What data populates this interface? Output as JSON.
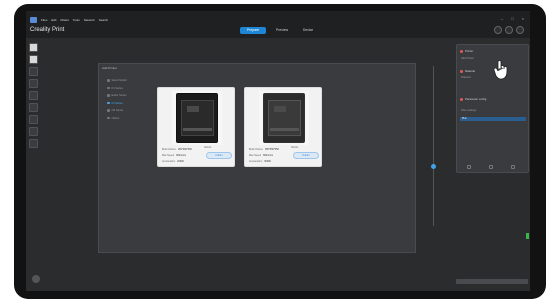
{
  "app": {
    "title": "Creality Print",
    "menu": [
      "Files",
      "Edit",
      "Model",
      "Tools",
      "Network",
      "Search"
    ]
  },
  "tabs": [
    {
      "label": "Prepare",
      "active": true
    },
    {
      "label": "Preview",
      "active": false
    },
    {
      "label": "Device",
      "active": false
    }
  ],
  "dialog": {
    "title": "Add Printer",
    "steps": [
      {
        "label": "Select Model",
        "active": false
      },
      {
        "label": "K1 Series",
        "active": false
      },
      {
        "label": "Ender Series",
        "active": false
      },
      {
        "label": "K2 Series",
        "active": true
      },
      {
        "label": "CR Series",
        "active": false
      },
      {
        "label": "Others",
        "active": false
      }
    ],
    "cards": [
      {
        "specs": [
          {
            "k": "Build Volume",
            "v": "260*260*300"
          },
          {
            "k": "Max Speed",
            "v": "600mm/s"
          },
          {
            "k": "Acceleration",
            "v": "20000"
          }
        ],
        "nozzle_label": "Nozzle",
        "nozzle_value": "0.4mm"
      },
      {
        "specs": [
          {
            "k": "Build Volume",
            "v": "350*350*350"
          },
          {
            "k": "Max Speed",
            "v": "600mm/s"
          },
          {
            "k": "Acceleration",
            "v": "30000"
          }
        ],
        "nozzle_label": "Nozzle",
        "nozzle_value": "0.4mm"
      }
    ]
  },
  "right_panel": {
    "printer_header": "Printer",
    "printer_sub": "Add Printer",
    "material_header": "Material",
    "material_sub": "Filament",
    "settings_header": "Parameter config",
    "settings_sub": "Slice settings",
    "filament_row": "PLA"
  },
  "accent_color": "#1f86d6"
}
